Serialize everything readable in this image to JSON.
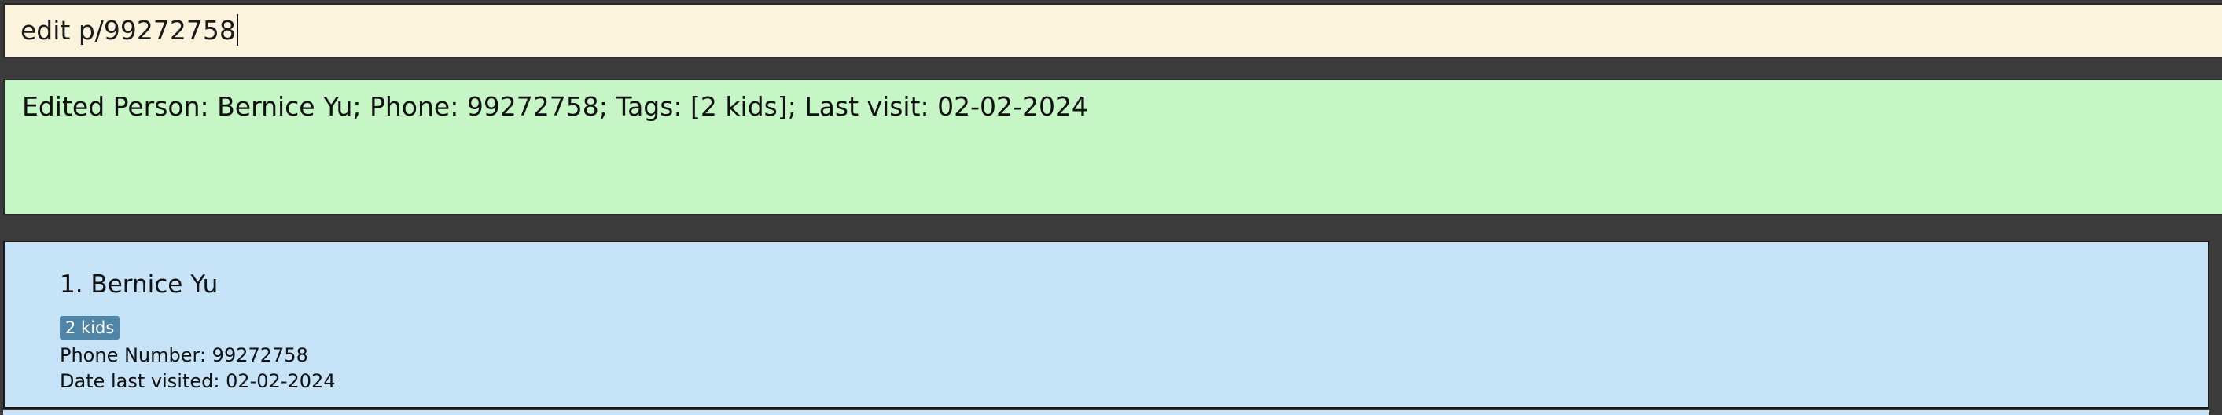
{
  "command": {
    "value": "edit p/99272758"
  },
  "result": {
    "message": "Edited Person: Bernice Yu; Phone: 99272758; Tags: [2 kids]; Last visit: 02-02-2024"
  },
  "persons": [
    {
      "name": "1. Bernice Yu",
      "tag": "2 kids",
      "phone": "Phone Number: 99272758",
      "last_visit": "Date last visited: 02-02-2024"
    }
  ],
  "colors": {
    "command_bg": "#fbf3dc",
    "result_bg": "#c6f6c5",
    "card_bg": "#c6e3f7",
    "tag_bg": "#4f86a8",
    "window_bg": "#3b3b3b"
  }
}
